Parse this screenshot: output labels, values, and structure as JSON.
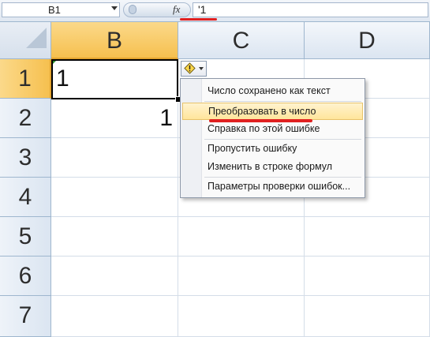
{
  "formula_bar": {
    "name_box": "B1",
    "fx_label": "fx",
    "formula": "'1"
  },
  "columns": [
    "B",
    "C",
    "D"
  ],
  "rows": [
    "1",
    "2",
    "3",
    "4",
    "5",
    "6",
    "7"
  ],
  "cells": {
    "B1": "1",
    "B2": "1"
  },
  "error_menu": {
    "header": "Число сохранено как текст",
    "items": [
      "Преобразовать в число",
      "Справка по этой ошибке",
      "Пропустить ошибку",
      "Изменить в строке формул",
      "Параметры проверки ошибок..."
    ]
  },
  "colors": {
    "selected_header": "#f6c04f",
    "highlight_underline": "#e02020",
    "error_marker": "#2c8b2c"
  }
}
